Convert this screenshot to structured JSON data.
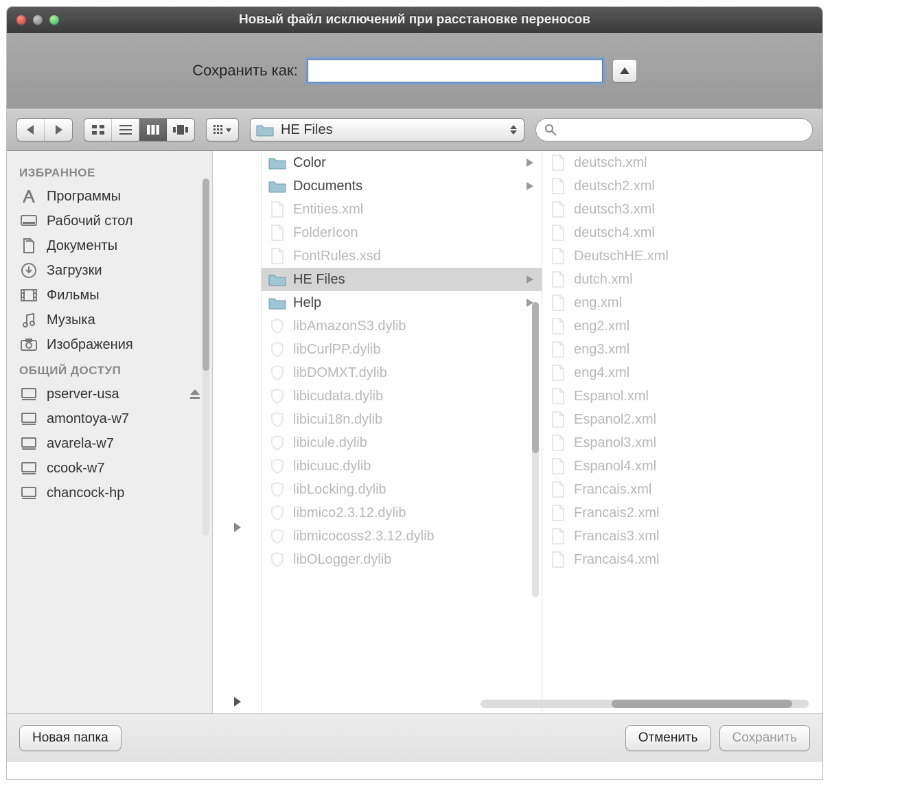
{
  "window": {
    "title": "Новый файл исключений при расстановке переносов"
  },
  "save": {
    "label": "Сохранить как:",
    "value": ""
  },
  "toolbar": {
    "path": "HE Files",
    "search_placeholder": ""
  },
  "sidebar": {
    "section1": "ИЗБРАННОЕ",
    "favorites": [
      "Программы",
      "Рабочий стол",
      "Документы",
      "Загрузки",
      "Фильмы",
      "Музыка",
      "Изображения"
    ],
    "section2": "ОБЩИЙ ДОСТУП",
    "shared": [
      "pserver-usa",
      "amontoya-w7",
      "avarela-w7",
      "ccook-w7",
      "chancock-hp"
    ]
  },
  "column1": [
    {
      "name": "Color",
      "type": "folder",
      "arrow": true
    },
    {
      "name": "Documents",
      "type": "folder",
      "arrow": true
    },
    {
      "name": "Entities.xml",
      "type": "file",
      "dim": true
    },
    {
      "name": "FolderIcon",
      "type": "file",
      "dim": true
    },
    {
      "name": "FontRules.xsd",
      "type": "file",
      "dim": true
    },
    {
      "name": "HE Files",
      "type": "folder",
      "arrow": true,
      "selected": true
    },
    {
      "name": "Help",
      "type": "folder",
      "arrow": true
    },
    {
      "name": "libAmazonS3.dylib",
      "type": "lib",
      "dim": true
    },
    {
      "name": "libCurlPP.dylib",
      "type": "lib",
      "dim": true
    },
    {
      "name": "libDOMXT.dylib",
      "type": "lib",
      "dim": true
    },
    {
      "name": "libicudata.dylib",
      "type": "lib",
      "dim": true
    },
    {
      "name": "libicui18n.dylib",
      "type": "lib",
      "dim": true
    },
    {
      "name": "libicule.dylib",
      "type": "lib",
      "dim": true
    },
    {
      "name": "libicuuc.dylib",
      "type": "lib",
      "dim": true
    },
    {
      "name": "libLocking.dylib",
      "type": "lib",
      "dim": true
    },
    {
      "name": "libmico2.3.12.dylib",
      "type": "lib",
      "dim": true
    },
    {
      "name": "libmicocoss2.3.12.dylib",
      "type": "lib",
      "dim": true
    },
    {
      "name": "libOLogger.dylib",
      "type": "lib",
      "dim": true
    }
  ],
  "column2": [
    {
      "name": "deutsch.xml"
    },
    {
      "name": "deutsch2.xml"
    },
    {
      "name": "deutsch3.xml"
    },
    {
      "name": "deutsch4.xml"
    },
    {
      "name": "DeutschHE.xml"
    },
    {
      "name": "dutch.xml"
    },
    {
      "name": "eng.xml"
    },
    {
      "name": "eng2.xml"
    },
    {
      "name": "eng3.xml"
    },
    {
      "name": "eng4.xml"
    },
    {
      "name": "Espanol.xml"
    },
    {
      "name": "Espanol2.xml"
    },
    {
      "name": "Espanol3.xml"
    },
    {
      "name": "Espanol4.xml"
    },
    {
      "name": "Francais.xml"
    },
    {
      "name": "Francais2.xml"
    },
    {
      "name": "Francais3.xml"
    },
    {
      "name": "Francais4.xml"
    }
  ],
  "footer": {
    "new_folder": "Новая папка",
    "cancel": "Отменить",
    "save": "Сохранить"
  }
}
